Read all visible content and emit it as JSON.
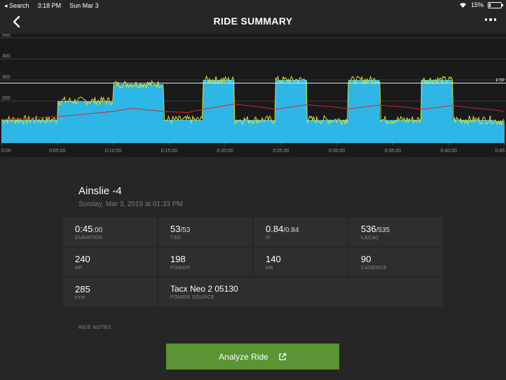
{
  "status_bar": {
    "back_app": "Search",
    "time": "3:18 PM",
    "date": "Sun Mar 3",
    "battery": "15%",
    "battery_level": 0.15
  },
  "nav": {
    "title": "RIDE SUMMARY",
    "back_icon": "chevron-left-icon",
    "more_icon": "more-dots-icon"
  },
  "colors": {
    "power_fill": "#2eb7e6",
    "power_line": "#e6e02a",
    "avg_line": "#d12a2a",
    "chart_bg": "#1a1a1a",
    "accent_button": "#5a9435"
  },
  "chart_data": {
    "type": "area",
    "title": "",
    "xlabel": "",
    "ylabel": "",
    "x_ticks": [
      "0:00",
      "0:05:00",
      "0:10:00",
      "0:15:00",
      "0:20:00",
      "0:25:00",
      "0:30:00",
      "0:35:00",
      "0:40:00",
      "0:45"
    ],
    "y_ticks": [
      "500",
      "400",
      "300",
      "200"
    ],
    "xlim_seconds": [
      0,
      2700
    ],
    "ylim": [
      0,
      520
    ],
    "ftp_line": {
      "label": "FTP",
      "value": 285
    },
    "grid": true,
    "series": [
      {
        "type": "area",
        "x_seconds": [
          0,
          300,
          301,
          600,
          601,
          870,
          871,
          1080,
          1081,
          1250,
          1251,
          1470,
          1471,
          1640,
          1641,
          1860,
          1861,
          2030,
          2031,
          2250,
          2251,
          2420,
          2421,
          2640,
          2641,
          2700
        ],
        "values": [
          110,
          110,
          200,
          200,
          280,
          280,
          110,
          110,
          300,
          300,
          110,
          110,
          300,
          300,
          110,
          110,
          300,
          300,
          110,
          110,
          300,
          300,
          110,
          110,
          105,
          105
        ]
      },
      {
        "type": "line",
        "x_seconds": [
          0,
          300,
          600,
          700,
          870,
          1000,
          1080,
          1250,
          1400,
          1470,
          1640,
          1800,
          1860,
          2030,
          2200,
          2250,
          2420,
          2550,
          2640,
          2700
        ],
        "values": [
          112,
          125,
          150,
          165,
          150,
          145,
          160,
          185,
          170,
          160,
          182,
          170,
          162,
          180,
          168,
          160,
          178,
          165,
          158,
          150
        ]
      }
    ]
  },
  "ride": {
    "name": "Ainslie -4",
    "date": "Sunday, Mar 3, 2019 at 01:33 PM"
  },
  "metrics": {
    "duration": {
      "value": "0:45",
      "sub": ":00",
      "label": "DURATION"
    },
    "tss": {
      "value": "53",
      "sub": "/53",
      "label": "TSS"
    },
    "if": {
      "value": "0.84",
      "sub": "/0.84",
      "label": "IF"
    },
    "kj": {
      "value": "536",
      "sub": "/535",
      "label": "kJ(Cal)"
    },
    "np": {
      "value": "240",
      "label": "NP"
    },
    "power": {
      "value": "198",
      "label": "POWER"
    },
    "hr": {
      "value": "140",
      "label": "HR"
    },
    "cadence": {
      "value": "90",
      "label": "CADENCE"
    },
    "ftp": {
      "value": "285",
      "label": "FTP"
    },
    "power_source": {
      "value": "Tacx Neo 2 05130",
      "label": "POWER SOURCE"
    }
  },
  "ride_notes_label": "RIDE NOTES",
  "analyze_button": {
    "label": "Analyze Ride",
    "icon": "external-link-icon"
  }
}
